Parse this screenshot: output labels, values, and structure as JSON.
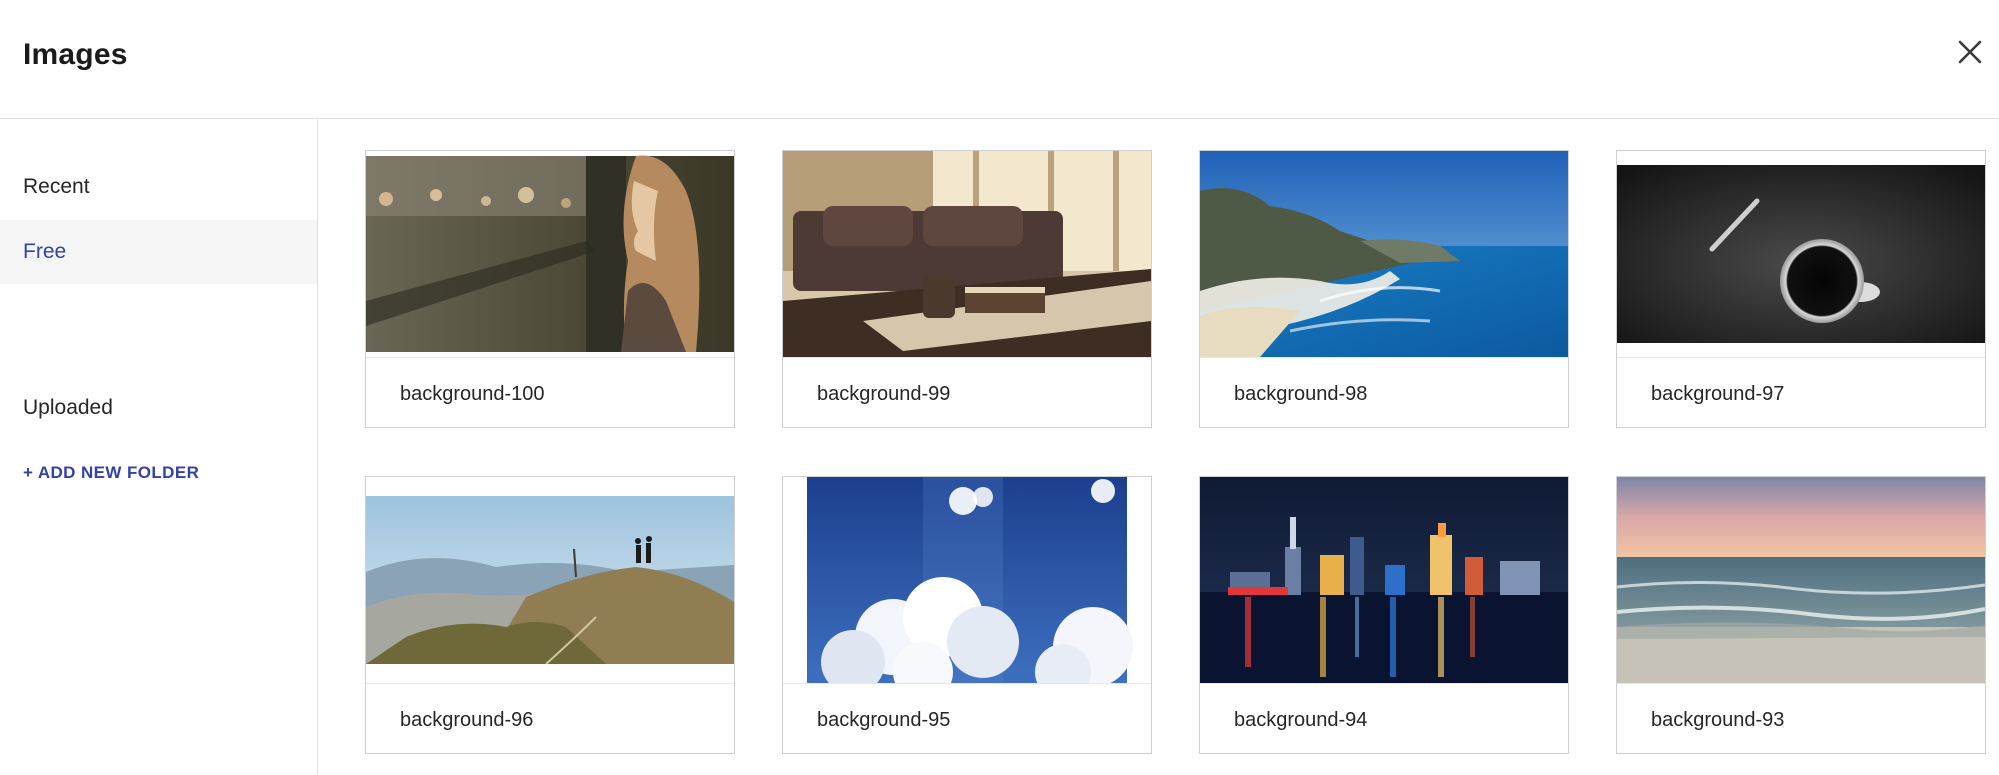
{
  "dialog": {
    "title": "Images",
    "close_icon": "close-icon"
  },
  "sidebar": {
    "items": [
      {
        "label": "Recent"
      },
      {
        "label": "Free",
        "active": true
      },
      {
        "label": "Uploaded"
      }
    ],
    "add_folder_label": "+ ADD NEW FOLDER"
  },
  "images": [
    {
      "name": "background-100",
      "scene": "woman looking out window"
    },
    {
      "name": "background-99",
      "scene": "sofa and table with cup and book"
    },
    {
      "name": "background-98",
      "scene": "coastal cliffs and ocean"
    },
    {
      "name": "background-97",
      "scene": "coffee cup and pen on dark surface"
    },
    {
      "name": "background-96",
      "scene": "hikers on mountain ridge"
    },
    {
      "name": "background-95",
      "scene": "clouds in blue sky"
    },
    {
      "name": "background-94",
      "scene": "city skyline at night over water"
    },
    {
      "name": "background-93",
      "scene": "beach at sunset"
    }
  ],
  "colors": {
    "accent": "#3342a8",
    "active_bg": "#f5f5f6",
    "border": "#cfcfcf"
  }
}
